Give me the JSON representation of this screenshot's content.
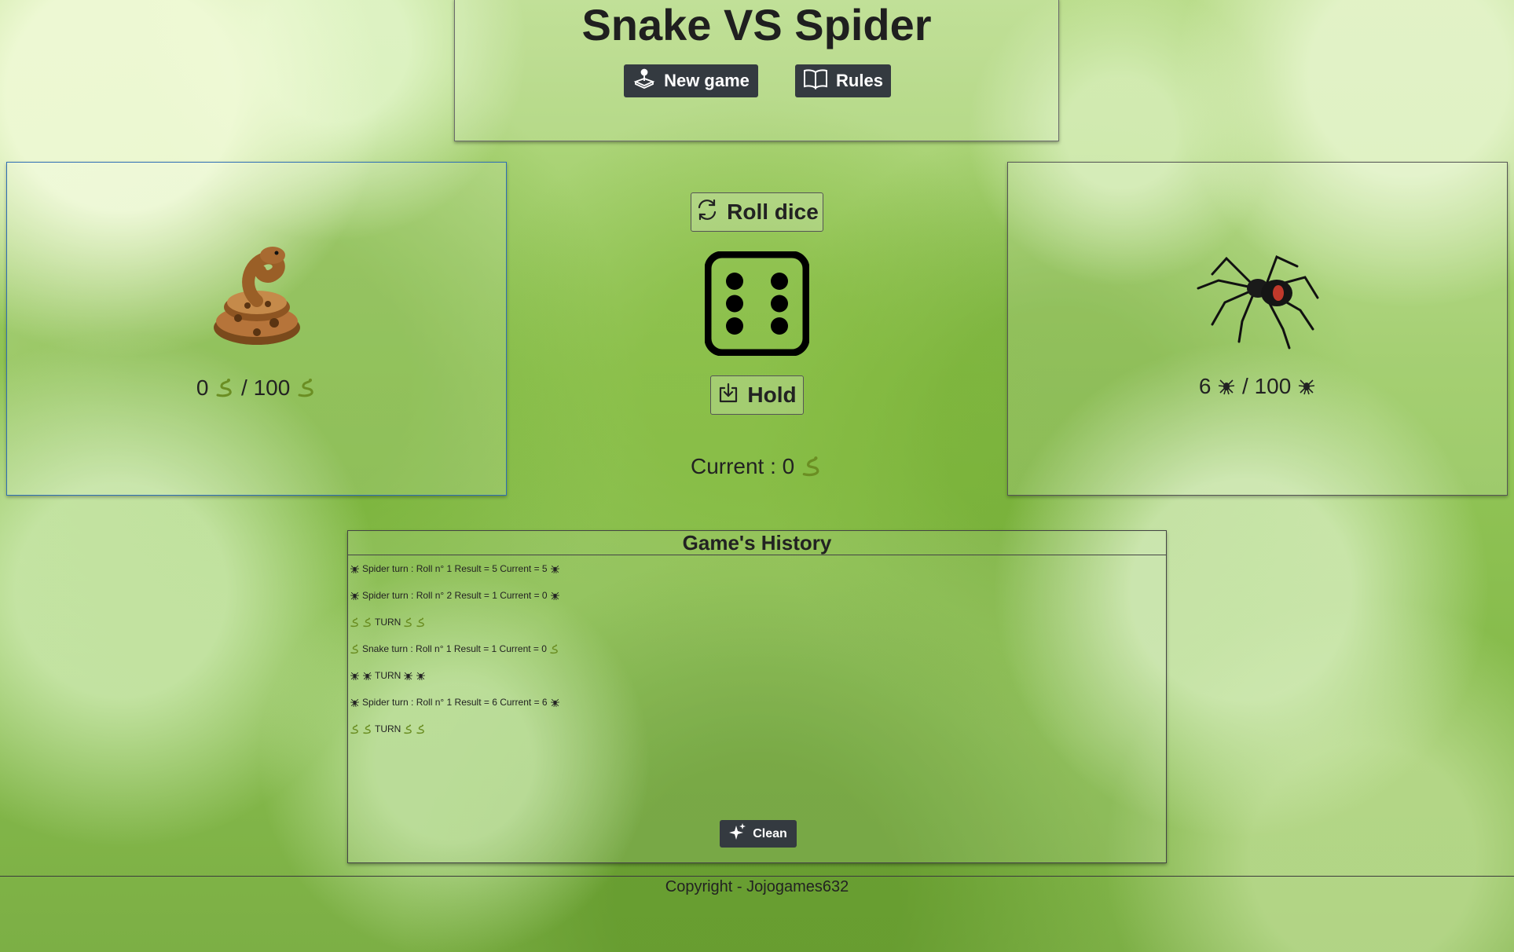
{
  "header": {
    "title": "Snake VS Spider",
    "new_game_label": "New game",
    "rules_label": "Rules"
  },
  "controls": {
    "roll_label": "Roll dice",
    "hold_label": "Hold",
    "dice_face": 6,
    "current_label": "Current : 0"
  },
  "players": [
    {
      "name": "snake",
      "score": "0",
      "goal": "100",
      "active": true
    },
    {
      "name": "spider",
      "score": "6",
      "goal": "100",
      "active": false
    }
  ],
  "history": {
    "title": "Game's History",
    "entries": [
      {
        "icon": "spider",
        "text": "Spider turn : Roll n° 1 Result = 5 Current = 5"
      },
      {
        "icon": "spider",
        "text": "Spider turn : Roll n° 2 Result = 1 Current = 0"
      },
      {
        "icon": "snake",
        "text": "TURN",
        "turn": true
      },
      {
        "icon": "snake",
        "text": "Snake turn : Roll n° 1 Result = 1 Current = 0"
      },
      {
        "icon": "spider",
        "text": "TURN",
        "turn": true
      },
      {
        "icon": "spider",
        "text": "Spider turn : Roll n° 1 Result = 6 Current = 6"
      },
      {
        "icon": "snake",
        "text": "TURN",
        "turn": true
      }
    ],
    "clean_label": "Clean"
  },
  "footer": {
    "copyright": "Copyright - Jojogames632"
  },
  "colors": {
    "dark_button": "#343a40",
    "active_panel_border": "#2f6fb5",
    "text": "#222222"
  },
  "icons": [
    "joystick-icon",
    "book-icon",
    "refresh-icon",
    "download-icon",
    "sparkles-icon",
    "snake-icon",
    "spider-icon"
  ]
}
